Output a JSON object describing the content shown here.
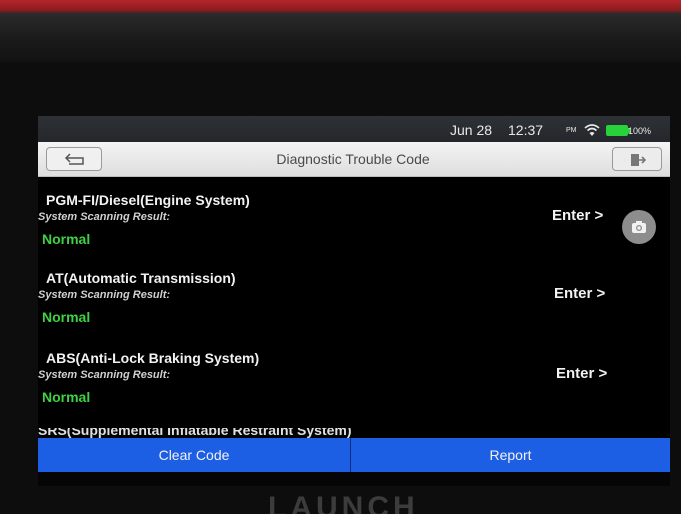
{
  "status_bar": {
    "date": "Jun 28",
    "time": "12:37",
    "ampm": "PM",
    "battery": "100%",
    "battery_color": "#27d23a"
  },
  "header": {
    "title": "Diagnostic Trouble Code",
    "back_icon": "back-arrow-icon",
    "exit_icon": "exit-icon"
  },
  "systems": [
    {
      "name": "PGM-FI/Diesel(Engine System)",
      "scan_label": "System Scanning Result:",
      "status": "Normal",
      "enter": "Enter >"
    },
    {
      "name": "AT(Automatic Transmission)",
      "scan_label": "System Scanning Result:",
      "status": "Normal",
      "enter": "Enter >"
    },
    {
      "name": "ABS(Anti-Lock Braking System)",
      "scan_label": "System Scanning Result:",
      "status": "Normal",
      "enter": "Enter >"
    }
  ],
  "clipped_item": "SRS(Supplemental Inflatable Restraint System)",
  "footer": {
    "clear_code": "Clear Code",
    "report": "Report",
    "button_color": "#1c5ee4"
  },
  "device_logo": "LAUNCH",
  "colors": {
    "normal_status": "#3ed142",
    "screen_bg": "#000000"
  }
}
